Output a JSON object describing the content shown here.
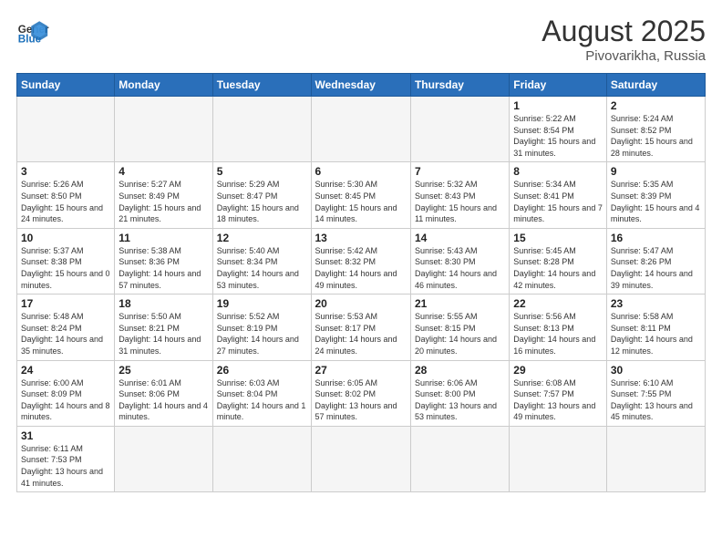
{
  "logo": {
    "text_general": "General",
    "text_blue": "Blue"
  },
  "header": {
    "month_year": "August 2025",
    "location": "Pivovarikha, Russia"
  },
  "days_of_week": [
    "Sunday",
    "Monday",
    "Tuesday",
    "Wednesday",
    "Thursday",
    "Friday",
    "Saturday"
  ],
  "weeks": [
    [
      {
        "day": "",
        "info": ""
      },
      {
        "day": "",
        "info": ""
      },
      {
        "day": "",
        "info": ""
      },
      {
        "day": "",
        "info": ""
      },
      {
        "day": "",
        "info": ""
      },
      {
        "day": "1",
        "info": "Sunrise: 5:22 AM\nSunset: 8:54 PM\nDaylight: 15 hours and 31 minutes."
      },
      {
        "day": "2",
        "info": "Sunrise: 5:24 AM\nSunset: 8:52 PM\nDaylight: 15 hours and 28 minutes."
      }
    ],
    [
      {
        "day": "3",
        "info": "Sunrise: 5:26 AM\nSunset: 8:50 PM\nDaylight: 15 hours and 24 minutes."
      },
      {
        "day": "4",
        "info": "Sunrise: 5:27 AM\nSunset: 8:49 PM\nDaylight: 15 hours and 21 minutes."
      },
      {
        "day": "5",
        "info": "Sunrise: 5:29 AM\nSunset: 8:47 PM\nDaylight: 15 hours and 18 minutes."
      },
      {
        "day": "6",
        "info": "Sunrise: 5:30 AM\nSunset: 8:45 PM\nDaylight: 15 hours and 14 minutes."
      },
      {
        "day": "7",
        "info": "Sunrise: 5:32 AM\nSunset: 8:43 PM\nDaylight: 15 hours and 11 minutes."
      },
      {
        "day": "8",
        "info": "Sunrise: 5:34 AM\nSunset: 8:41 PM\nDaylight: 15 hours and 7 minutes."
      },
      {
        "day": "9",
        "info": "Sunrise: 5:35 AM\nSunset: 8:39 PM\nDaylight: 15 hours and 4 minutes."
      }
    ],
    [
      {
        "day": "10",
        "info": "Sunrise: 5:37 AM\nSunset: 8:38 PM\nDaylight: 15 hours and 0 minutes."
      },
      {
        "day": "11",
        "info": "Sunrise: 5:38 AM\nSunset: 8:36 PM\nDaylight: 14 hours and 57 minutes."
      },
      {
        "day": "12",
        "info": "Sunrise: 5:40 AM\nSunset: 8:34 PM\nDaylight: 14 hours and 53 minutes."
      },
      {
        "day": "13",
        "info": "Sunrise: 5:42 AM\nSunset: 8:32 PM\nDaylight: 14 hours and 49 minutes."
      },
      {
        "day": "14",
        "info": "Sunrise: 5:43 AM\nSunset: 8:30 PM\nDaylight: 14 hours and 46 minutes."
      },
      {
        "day": "15",
        "info": "Sunrise: 5:45 AM\nSunset: 8:28 PM\nDaylight: 14 hours and 42 minutes."
      },
      {
        "day": "16",
        "info": "Sunrise: 5:47 AM\nSunset: 8:26 PM\nDaylight: 14 hours and 39 minutes."
      }
    ],
    [
      {
        "day": "17",
        "info": "Sunrise: 5:48 AM\nSunset: 8:24 PM\nDaylight: 14 hours and 35 minutes."
      },
      {
        "day": "18",
        "info": "Sunrise: 5:50 AM\nSunset: 8:21 PM\nDaylight: 14 hours and 31 minutes."
      },
      {
        "day": "19",
        "info": "Sunrise: 5:52 AM\nSunset: 8:19 PM\nDaylight: 14 hours and 27 minutes."
      },
      {
        "day": "20",
        "info": "Sunrise: 5:53 AM\nSunset: 8:17 PM\nDaylight: 14 hours and 24 minutes."
      },
      {
        "day": "21",
        "info": "Sunrise: 5:55 AM\nSunset: 8:15 PM\nDaylight: 14 hours and 20 minutes."
      },
      {
        "day": "22",
        "info": "Sunrise: 5:56 AM\nSunset: 8:13 PM\nDaylight: 14 hours and 16 minutes."
      },
      {
        "day": "23",
        "info": "Sunrise: 5:58 AM\nSunset: 8:11 PM\nDaylight: 14 hours and 12 minutes."
      }
    ],
    [
      {
        "day": "24",
        "info": "Sunrise: 6:00 AM\nSunset: 8:09 PM\nDaylight: 14 hours and 8 minutes."
      },
      {
        "day": "25",
        "info": "Sunrise: 6:01 AM\nSunset: 8:06 PM\nDaylight: 14 hours and 4 minutes."
      },
      {
        "day": "26",
        "info": "Sunrise: 6:03 AM\nSunset: 8:04 PM\nDaylight: 14 hours and 1 minute."
      },
      {
        "day": "27",
        "info": "Sunrise: 6:05 AM\nSunset: 8:02 PM\nDaylight: 13 hours and 57 minutes."
      },
      {
        "day": "28",
        "info": "Sunrise: 6:06 AM\nSunset: 8:00 PM\nDaylight: 13 hours and 53 minutes."
      },
      {
        "day": "29",
        "info": "Sunrise: 6:08 AM\nSunset: 7:57 PM\nDaylight: 13 hours and 49 minutes."
      },
      {
        "day": "30",
        "info": "Sunrise: 6:10 AM\nSunset: 7:55 PM\nDaylight: 13 hours and 45 minutes."
      }
    ],
    [
      {
        "day": "31",
        "info": "Sunrise: 6:11 AM\nSunset: 7:53 PM\nDaylight: 13 hours and 41 minutes."
      },
      {
        "day": "",
        "info": ""
      },
      {
        "day": "",
        "info": ""
      },
      {
        "day": "",
        "info": ""
      },
      {
        "day": "",
        "info": ""
      },
      {
        "day": "",
        "info": ""
      },
      {
        "day": "",
        "info": ""
      }
    ]
  ]
}
